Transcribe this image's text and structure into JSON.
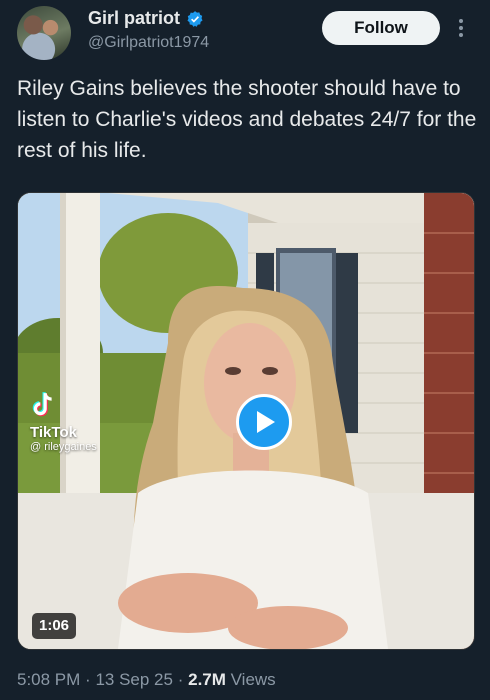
{
  "header": {
    "display_name": "Girl patriot",
    "handle": "@Girlpatriot1974",
    "follow_label": "Follow"
  },
  "tweet": {
    "text": "Riley Gains believes the shooter should have to listen to Charlie's videos and debates 24/7 for the rest of his life."
  },
  "video": {
    "watermark_brand": "TikTok",
    "watermark_handle": "@ rileygaines",
    "duration": "1:06"
  },
  "meta": {
    "time": "5:08 PM",
    "sep1": "·",
    "date": "13 Sep 25",
    "sep2": "·",
    "views_count": "2.7M",
    "views_label": "Views"
  },
  "colors": {
    "background": "#15202b",
    "accent": "#1d9bf0",
    "secondary_text": "#8b98a5"
  },
  "icons": [
    "verified-badge-icon",
    "more-options-icon",
    "play-icon",
    "tiktok-logo-icon"
  ]
}
